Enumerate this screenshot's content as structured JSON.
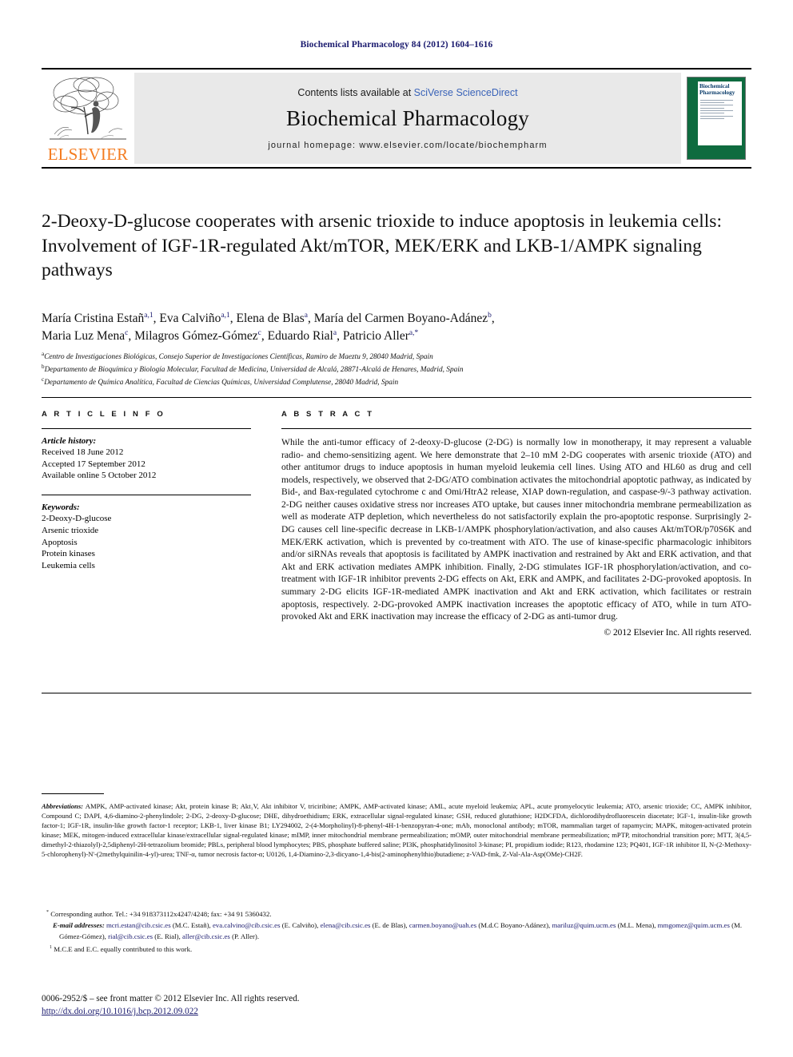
{
  "running_head": "Biochemical Pharmacology 84 (2012) 1604–1616",
  "masthead": {
    "contents_prefix": "Contents lists available at ",
    "sciencedirect": "SciVerse ScienceDirect",
    "journal_title": "Biochemical Pharmacology",
    "homepage": "journal homepage: www.elsevier.com/locate/biochempharm",
    "publisher_logo_text": "ELSEVIER",
    "cover_title": "Biochemical Pharmacology",
    "brand_green": "#0e6b3f",
    "brand_orange": "#F47C20",
    "link_blue": "#3a63b8"
  },
  "article": {
    "title": "2-Deoxy-D-glucose cooperates with arsenic trioxide to induce apoptosis in leukemia cells: Involvement of IGF-1R-regulated Akt/mTOR, MEK/ERK and LKB-1/AMPK signaling pathways",
    "authors": "María Cristina Estañ a,1, Eva Calviño a,1, Elena de Blas a, María del Carmen Boyano-Adánez b, Maria Luz Mena c, Milagros Gómez-Gómez c, Eduardo Rial a, Patricio Aller a,*",
    "affiliations": [
      "Centro de Investigaciones Biológicas, Consejo Superior de Investigaciones Científicas, Ramiro de Maeztu 9, 28040 Madrid, Spain",
      "Departamento de Bioquímica y Biología Molecular, Facultad de Medicina, Universidad de Alcalá, 28871-Alcalá de Henares, Madrid, Spain",
      "Departamento de Química Analítica, Facultad de Ciencias Químicas, Universidad Complutense, 28040 Madrid, Spain"
    ],
    "affiliation_marks": [
      "a",
      "b",
      "c"
    ]
  },
  "article_info": {
    "heading": "A R T I C L E  I N F O",
    "history_label": "Article history:",
    "history": [
      "Received 18 June 2012",
      "Accepted 17 September 2012",
      "Available online 5 October 2012"
    ],
    "keywords_label": "Keywords:",
    "keywords": [
      "2-Deoxy-D-glucose",
      "Arsenic trioxide",
      "Apoptosis",
      "Protein kinases",
      "Leukemia cells"
    ]
  },
  "abstract": {
    "heading": "A B S T R A C T",
    "body": "While the anti-tumor efficacy of 2-deoxy-D-glucose (2-DG) is normally low in monotherapy, it may represent a valuable radio- and chemo-sensitizing agent. We here demonstrate that 2–10 mM 2-DG cooperates with arsenic trioxide (ATO) and other antitumor drugs to induce apoptosis in human myeloid leukemia cell lines. Using ATO and HL60 as drug and cell models, respectively, we observed that 2-DG/ATO combination activates the mitochondrial apoptotic pathway, as indicated by Bid-, and Bax-regulated cytochrome c and Omi/HtrA2 release, XIAP down-regulation, and caspase-9/-3 pathway activation. 2-DG neither causes oxidative stress nor increases ATO uptake, but causes inner mitochondria membrane permeabilization as well as moderate ATP depletion, which nevertheless do not satisfactorily explain the pro-apoptotic response. Surprisingly 2-DG causes cell line-specific decrease in LKB-1/AMPK phosphorylation/activation, and also causes Akt/mTOR/p70S6K and MEK/ERK activation, which is prevented by co-treatment with ATO. The use of kinase-specific pharmacologic inhibitors and/or siRNAs reveals that apoptosis is facilitated by AMPK inactivation and restrained by Akt and ERK activation, and that Akt and ERK activation mediates AMPK inhibition. Finally, 2-DG stimulates IGF-1R phosphorylation/activation, and co-treatment with IGF-1R inhibitor prevents 2-DG effects on Akt, ERK and AMPK, and facilitates 2-DG-provoked apoptosis. In summary 2-DG elicits IGF-1R-mediated AMPK inactivation and Akt and ERK activation, which facilitates or restrain apoptosis, respectively. 2-DG-provoked AMPK inactivation increases the apoptotic efficacy of ATO, while in turn ATO-provoked Akt and ERK inactivation may increase the efficacy of 2-DG as anti-tumor drug.",
    "copyright": "© 2012 Elsevier Inc. All rights reserved."
  },
  "abbreviations": {
    "label": "Abbreviations:",
    "text": "AMPK, AMP-activated kinase; Akt, protein kinase B; Akt₁V, Akt inhibitor V, triciribine; AMPK, AMP-activated kinase; AML, acute myeloid leukemia; APL, acute promyelocytic leukemia; ATO, arsenic trioxide; CC, AMPK inhibitor, Compound C; DAPI, 4,6-diamino-2-phenylindole; 2-DG, 2-deoxy-D-glucose; DHE, dihydroethidium; ERK, extracellular signal-regulated kinase; GSH, reduced glutathione; H2DCFDA, dichlorodihydrofluorescein diacetate; IGF-1, insulin-like growth factor-1; IGF-1R, insulin-like growth factor-1 receptor; LKB-1, liver kinase B1; LY294002, 2-(4-Morpholinyl)-8-phenyl-4H-1-benzopyran-4-one; mAb, monoclonal antibody; mTOR, mammalian target of rapamycin; MAPK, mitogen-activated protein kinase; MEK, mitogen-induced extracellular kinase/extracellular signal-regulated kinase; mIMP, inner mitochondrial membrane permeabilization; mOMP, outer mitochondrial membrane permeabilization; mPTP, mitochondrial transition pore; MTT, 3(4,5-dimethyl-2-thiazolyl)-2,5diphenyl-2H-tetrazolium bromide; PBLs, peripheral blood lymphocytes; PBS, phosphate buffered saline; PI3K, phosphatidylinositol 3-kinase; PI, propidium iodide; R123, rhodamine 123; PQ401, IGF-1R inhibitor II, N-(2-Methoxy-5-chlorophenyl)-N'-(2methylquinilin-4-yl)-urea; TNF-α, tumor necrosis factor-α; U0126, 1,4-Diamino-2,3-dicyano-1,4-bis(2-aminophenylthio)butadiene; z-VAD-fmk, Z-Val-Ala-Asp(OMe)-CH2F."
  },
  "correspondence": {
    "star": "*",
    "line": "Corresponding author. Tel.: +34 918373112x4247/4248; fax: +34 91 5360432.",
    "email_label": "E-mail addresses:",
    "emails": [
      {
        "address": "mcri.estan@cib.csic.es",
        "name": "(M.C. Estañ)"
      },
      {
        "address": "eva.calvino@cib.csic.es",
        "name": "(E. Calviño)"
      },
      {
        "address": "elena@cib.csic.es",
        "name": "(E. de Blas)"
      },
      {
        "address": "carmen.boyano@uah.es",
        "name": "(M.d.C Boyano-Adánez)"
      },
      {
        "address": "mariluz@quim.ucm.es",
        "name": "(M.L. Mena)"
      },
      {
        "address": "mmgomez@quim.ucm.es",
        "name": "(M. Gómez-Gómez)"
      },
      {
        "address": "rial@cib.csic.es",
        "name": "(E. Rial)"
      },
      {
        "address": "aller@cib.csic.es",
        "name": "(P. Aller)"
      }
    ],
    "equal_mark": "1",
    "equal_contribution": "M.C.E and E.C. equally contributed to this work."
  },
  "footer": {
    "issn_line": "0006-2952/$ – see front matter © 2012 Elsevier Inc. All rights reserved.",
    "doi": "http://dx.doi.org/10.1016/j.bcp.2012.09.022"
  }
}
